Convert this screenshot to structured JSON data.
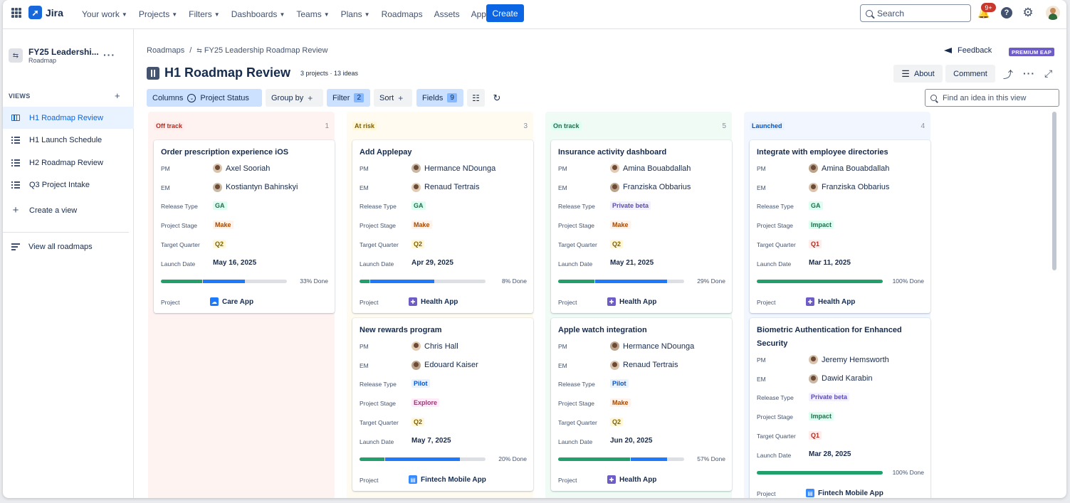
{
  "topnav": {
    "app_name": "Jira",
    "items": [
      {
        "label": "Your work",
        "chevron": true
      },
      {
        "label": "Projects",
        "chevron": true
      },
      {
        "label": "Filters",
        "chevron": true
      },
      {
        "label": "Dashboards",
        "chevron": true
      },
      {
        "label": "Teams",
        "chevron": true
      },
      {
        "label": "Plans",
        "chevron": true
      },
      {
        "label": "Roadmaps",
        "chevron": false
      },
      {
        "label": "Assets",
        "chevron": false
      },
      {
        "label": "Apps",
        "chevron": true
      }
    ],
    "create_label": "Create",
    "search_placeholder": "Search",
    "notifications_badge": "9+",
    "help_glyph": "?"
  },
  "sidebar": {
    "project_name": "FY25 Leadershi...",
    "project_type": "Roadmap",
    "views_label": "VIEWS",
    "views": [
      {
        "label": "H1 Roadmap Review",
        "icon": "board-icon",
        "active": true
      },
      {
        "label": "H1 Launch Schedule",
        "icon": "list-icon",
        "active": false
      },
      {
        "label": "H2 Roadmap Review",
        "icon": "list-icon",
        "active": false
      },
      {
        "label": "Q3 Project Intake",
        "icon": "list-icon",
        "active": false
      }
    ],
    "create_view_label": "Create a view",
    "view_all_label": "View all roadmaps"
  },
  "header": {
    "breadcrumb_root": "Roadmaps",
    "breadcrumb_separator": "/",
    "breadcrumb_current": "FY25 Leadership Roadmap Review",
    "feedback_label": "Feedback",
    "premium_label": "PREMIUM EAP",
    "title": "H1 Roadmap Review",
    "meta": "3 projects · 13 ideas",
    "about_label": "About",
    "comment_label": "Comment"
  },
  "toolbar": {
    "columns_label": "Columns",
    "columns_value": "Project Status",
    "group_by_label": "Group by",
    "filter_label": "Filter",
    "filter_count": "2",
    "sort_label": "Sort",
    "fields_label": "Fields",
    "fields_count": "9",
    "find_placeholder": "Find an idea in this view"
  },
  "colors": {
    "off_track_bg": "#fff3f2",
    "at_risk_bg": "#fffbf0",
    "on_track_bg": "#effbf4",
    "launched_bg": "#f2f7ff",
    "done_bar": "#22a06b",
    "progress_bar": "#1d7afc"
  },
  "field_labels": {
    "pm": "PM",
    "em": "EM",
    "release_type": "Release Type",
    "project_stage": "Project Stage",
    "target_quarter": "Target Quarter",
    "launch_date": "Launch Date",
    "project": "Project"
  },
  "columns": [
    {
      "name": "Off track",
      "count": "1",
      "cards": [
        {
          "title": "Order prescription experience iOS",
          "pm": "Axel Sooriah",
          "em": "Kostiantyn Bahinskyi",
          "release_type": "GA",
          "stage": "Make",
          "quarter": "Q2",
          "launch_date": "May 16, 2025",
          "done": 0.33,
          "progress": 0.33,
          "progress_label": "33% Done",
          "project": "Care App",
          "project_icon": "cloud-icon"
        }
      ]
    },
    {
      "name": "At risk",
      "count": "3",
      "cards": [
        {
          "title": "Add Applepay",
          "pm": "Hermance NDounga",
          "em": "Renaud Tertrais",
          "release_type": "GA",
          "stage": "Make",
          "quarter": "Q2",
          "launch_date": "Apr 29, 2025",
          "done": 0.08,
          "progress": 0.51,
          "progress_label": "8% Done",
          "project": "Health App",
          "project_icon": "health-icon"
        },
        {
          "title": "New rewards program",
          "pm": "Chris Hall",
          "em": "Edouard Kaiser",
          "release_type": "Pilot",
          "stage": "Explore",
          "quarter": "Q2",
          "launch_date": "May 7, 2025",
          "done": 0.2,
          "progress": 0.59,
          "progress_label": "20% Done",
          "project": "Fintech Mobile App",
          "project_icon": "fintech-icon"
        }
      ]
    },
    {
      "name": "On track",
      "count": "5",
      "cards": [
        {
          "title": "Insurance activity dashboard",
          "pm": "Amina Bouabdallah",
          "em": "Franziska Obbarius",
          "release_type": "Private beta",
          "stage": "Make",
          "quarter": "Q2",
          "launch_date": "May 21, 2025",
          "done": 0.29,
          "progress": 0.57,
          "progress_label": "29% Done",
          "project": "Health App",
          "project_icon": "health-icon"
        },
        {
          "title": "Apple watch integration",
          "pm": "Hermance NDounga",
          "em": "Renaud Tertrais",
          "release_type": "Pilot",
          "stage": "Make",
          "quarter": "Q2",
          "launch_date": "Jun 20, 2025",
          "done": 0.57,
          "progress": 0.29,
          "progress_label": "57% Done",
          "project": "Health App",
          "project_icon": "health-icon"
        }
      ]
    },
    {
      "name": "Launched",
      "count": "4",
      "cards": [
        {
          "title": "Integrate with employee directories",
          "pm": "Amina Bouabdallah",
          "em": "Franziska Obbarius",
          "release_type": "GA",
          "stage": "Impact",
          "quarter": "Q1",
          "launch_date": "Mar 11, 2025",
          "done": 1.0,
          "progress": 0,
          "progress_label": "100% Done",
          "project": "Health App",
          "project_icon": "health-icon"
        },
        {
          "title": "Biometric Authentication for Enhanced Security",
          "pm": "Jeremy Hemsworth",
          "em": "Dawid Karabin",
          "release_type": "Private beta",
          "stage": "Impact",
          "quarter": "Q1",
          "launch_date": "Mar 28, 2025",
          "done": 1.0,
          "progress": 0,
          "progress_label": "100% Done",
          "project": "Fintech Mobile App",
          "project_icon": "fintech-icon"
        }
      ]
    }
  ]
}
